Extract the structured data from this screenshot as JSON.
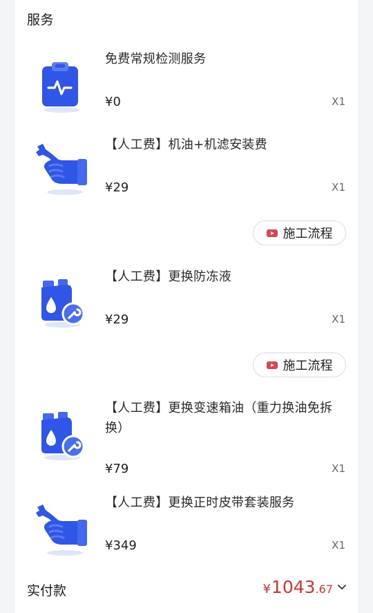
{
  "section": {
    "title": "服务"
  },
  "items": [
    {
      "name": "免费常规检测服务",
      "price": "¥0",
      "qty": "X1",
      "icon": "clipboard-pulse-icon"
    },
    {
      "name": "【人工费】机油+机滤安装费",
      "price": "¥29",
      "qty": "X1",
      "icon": "hand-wrench-icon"
    },
    {
      "name": "【人工费】更换防冻液",
      "price": "¥29",
      "qty": "X1",
      "icon": "fluid-canister-wrench-icon"
    },
    {
      "name": "【人工费】更换变速箱油（重力换油免拆换）",
      "price": "¥79",
      "qty": "X1",
      "icon": "fluid-canister-wrench-icon"
    },
    {
      "name": "【人工费】更换正时皮带套装服务",
      "price": "¥349",
      "qty": "X1",
      "icon": "hand-wrench-icon"
    }
  ],
  "process_button": {
    "label": "施工流程"
  },
  "total": {
    "label": "实付款",
    "currency": "¥",
    "integer": "1043",
    "decimal": ".67"
  },
  "colors": {
    "price_accent": "#d8342b",
    "icon_blue": "#2f56e6",
    "video_icon": "#e0424f"
  }
}
